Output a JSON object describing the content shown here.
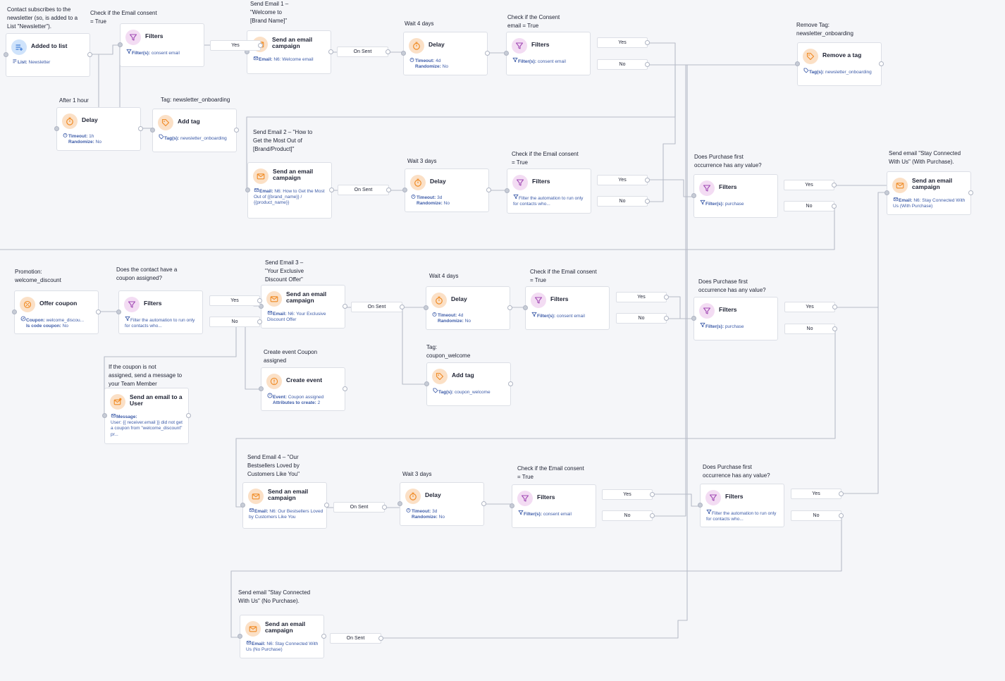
{
  "nodes": {
    "n1": {
      "type": "Added to list",
      "label": "Contact subscribes to the\nnewsletter (so, is added to a\nList \"Newsletter\").",
      "details": [
        {
          "key": "List:",
          "value": "Newsletter"
        }
      ]
    },
    "n2": {
      "type": "Filters",
      "label": "Check if the Email consent\n= True",
      "details": [
        {
          "key": "Filter(s):",
          "value": "consent email"
        }
      ]
    },
    "n3": {
      "type": "Send an email\ncampaign",
      "label": "Send Email 1 –\n\"Welcome to\n[Brand Name]\"",
      "details": [
        {
          "key": "Email:",
          "value": "N6: Welcome email"
        }
      ]
    },
    "n4": {
      "type": "Delay",
      "label": "Wait 4 days",
      "details": [
        {
          "key": "Timeout:",
          "value": "4d"
        },
        {
          "key": "Randomize:",
          "value": "No"
        }
      ]
    },
    "n5": {
      "type": "Filters",
      "label": "Check if the Consent\nemail = True",
      "details": [
        {
          "key": "Filter(s):",
          "value": "consent email"
        }
      ]
    },
    "n6": {
      "type": "Remove a tag",
      "label": "Remove Tag:\nnewsletter_onboarding",
      "details": [
        {
          "key": "Tag(s):",
          "value": "newsletter_onboarding"
        }
      ]
    },
    "n7": {
      "type": "Delay",
      "label": "After 1 hour",
      "details": [
        {
          "key": "Timeout:",
          "value": "1h"
        },
        {
          "key": "Randomize:",
          "value": "No"
        }
      ]
    },
    "n8": {
      "type": "Add tag",
      "label": "Tag: newsletter_onboarding",
      "details": [
        {
          "key": "Tag(s):",
          "value": "newsletter_onboarding"
        }
      ]
    },
    "n9": {
      "type": "Send an email\ncampaign",
      "label": "Send Email 2 – \"How to\nGet the Most Out of\n[Brand/Product]\"",
      "details": [
        {
          "key": "Email:",
          "value": "N6: How to Get the Most Out of {{brand_name}} / {{product_name}}"
        }
      ]
    },
    "n10": {
      "type": "Delay",
      "label": "Wait 3 days",
      "details": [
        {
          "key": "Timeout:",
          "value": "3d"
        },
        {
          "key": "Randomize:",
          "value": "No"
        }
      ]
    },
    "n11": {
      "type": "Filters",
      "label": "Check if the Email consent\n= True",
      "details": [
        {
          "key": "",
          "value": "Filter the automation to run only for contacts who..."
        }
      ]
    },
    "n12": {
      "type": "Filters",
      "label": "Does Purchase first\noccurrence has any value?",
      "details": [
        {
          "key": "Filter(s):",
          "value": "purchase"
        }
      ]
    },
    "n13": {
      "type": "Send an email\ncampaign",
      "label": "Send email \"Stay Connected\nWith Us\" (With Purchase).",
      "details": [
        {
          "key": "Email:",
          "value": "N6: Stay Connected With Us (With Purchase)"
        }
      ]
    },
    "n14": {
      "type": "Offer coupon",
      "label": "Promotion:\nwelcome_discount",
      "details": [
        {
          "key": "Coupon:",
          "value": "welcome_discou..."
        },
        {
          "key": "Is code coupon:",
          "value": "No"
        }
      ]
    },
    "n15": {
      "type": "Filters",
      "label": "Does the contact have a\ncoupon assigned?",
      "details": [
        {
          "key": "",
          "value": "Filter the automation to run only for contacts who..."
        }
      ]
    },
    "n16": {
      "type": "Send an email\ncampaign",
      "label": "Send Email 3 –\n\"Your Exclusive\nDiscount Offer\"",
      "details": [
        {
          "key": "Email:",
          "value": "N6: Your Exclusive Discount Offer"
        }
      ]
    },
    "n17": {
      "type": "Delay",
      "label": "Wait 4 days",
      "details": [
        {
          "key": "Timeout:",
          "value": "4d"
        },
        {
          "key": "Randomize:",
          "value": "No"
        }
      ]
    },
    "n18": {
      "type": "Filters",
      "label": "Check if the Email consent\n= True",
      "details": [
        {
          "key": "Filter(s):",
          "value": "consent email"
        }
      ]
    },
    "n19": {
      "type": "Filters",
      "label": "Does Purchase first\noccurrence has any value?",
      "details": [
        {
          "key": "Filter(s):",
          "value": "purchase"
        }
      ]
    },
    "n20": {
      "type": "Send an email to a\nUser",
      "label": "If the coupon is not\nassigned, send a message to\nyour Team Member",
      "details": [
        {
          "key": "Message:",
          "value": ""
        },
        {
          "key": "",
          "value": "User: {{ receiver.email }} did not get a coupon from \"welcome_discount\" pr..."
        }
      ]
    },
    "n21": {
      "type": "Create event",
      "label": "Create event Coupon\nassigned",
      "details": [
        {
          "key": "Event:",
          "value": "Coupon assigned"
        },
        {
          "key": "Attributes to create:",
          "value": "2"
        }
      ]
    },
    "n22": {
      "type": "Add tag",
      "label": "Tag:\ncoupon_welcome",
      "details": [
        {
          "key": "Tag(s):",
          "value": "coupon_welcome"
        }
      ]
    },
    "n23": {
      "type": "Send an email\ncampaign",
      "label": "Send Email 4 – \"Our\nBestsellers Loved by\nCustomers Like You\"",
      "details": [
        {
          "key": "Email:",
          "value": "N6: Our Bestsellers Loved by Customers Like You"
        }
      ]
    },
    "n24": {
      "type": "Delay",
      "label": "Wait 3 days",
      "details": [
        {
          "key": "Timeout:",
          "value": "3d"
        },
        {
          "key": "Randomize:",
          "value": "No"
        }
      ]
    },
    "n25": {
      "type": "Filters",
      "label": "Check if the Email consent\n= True",
      "details": [
        {
          "key": "Filter(s):",
          "value": "consent email"
        }
      ]
    },
    "n26": {
      "type": "Filters",
      "label": "Does Purchase first\noccurrence has any value?",
      "details": [
        {
          "key": "",
          "value": "Filter the automation to run only for contacts who..."
        }
      ]
    },
    "n27": {
      "type": "Send an email\ncampaign",
      "label": "Send email \"Stay Connected\nWith Us\" (No Purchase).",
      "details": [
        {
          "key": "Email:",
          "value": "N6: Stay Connected With Us (No Purchase)"
        }
      ]
    }
  },
  "branches": {
    "yes": "Yes",
    "no": "No",
    "on_sent": "On Sent"
  },
  "icons": {
    "delay": "timer-icon",
    "filter": "funnel-icon",
    "email": "envelope-icon",
    "tag": "tag-icon",
    "list": "list-add-icon",
    "coupon": "coupon-icon",
    "event": "event-icon",
    "user_email": "envelope-user-icon"
  },
  "colors": {
    "orange_icon": "#f08a24",
    "pink_icon": "#a24bb5",
    "blue_icon": "#3a79d6",
    "detail_text": "#3c5ba8",
    "edge": "#b7bcc8"
  }
}
